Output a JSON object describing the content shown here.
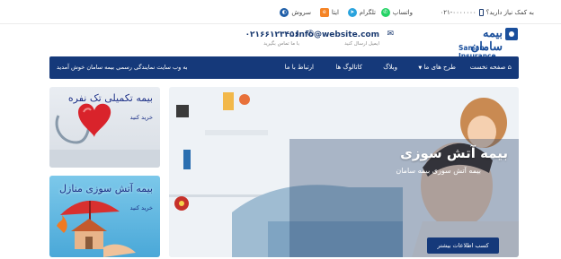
{
  "topbar": {
    "help_text": "به کمک نیاز دارید؟",
    "help_phone": "۰۲۱-۰۰۰۰۰۰۰",
    "social": [
      {
        "label": "واتساپ",
        "icon": "whatsapp-icon",
        "color": "#25d366"
      },
      {
        "label": "تلگرام",
        "icon": "telegram-icon",
        "color": "#2aa3dd"
      },
      {
        "label": "ایتا",
        "icon": "eitaa-icon",
        "color": "#f58426"
      },
      {
        "label": "سروش",
        "icon": "soroush-icon",
        "color": "#1f5ea8"
      }
    ]
  },
  "header": {
    "logo_fa": "بیمه سامان",
    "logo_en": "Saman Insurance",
    "email": "info@website.com",
    "email_sub": "ایمیل ارسال کنید",
    "phone": "۰۲۱۶۶۱۲۳۴۵۶",
    "phone_sub": "با ما تماس بگیرید"
  },
  "nav": {
    "items": [
      {
        "label": "صفحه نخست",
        "icon": "home-icon"
      },
      {
        "label": "طرح های ما",
        "has_dropdown": true
      },
      {
        "label": "وبلاگ"
      },
      {
        "label": "کاتالوگ ها"
      },
      {
        "label": "ارتباط با ما"
      }
    ],
    "welcome": "به وب سایت نمایندگی رسمی بیمه سامان خوش آمدید"
  },
  "cards": [
    {
      "title": "بیمه تکمیلی تک نفره",
      "link": "خرید کنید"
    },
    {
      "title": "بیمه آتش سوزی منازل",
      "link": "خرید کنید"
    }
  ],
  "hero": {
    "title": "بیمه آتش سوزی",
    "subtitle": "بیمه آتش سوزی بیمه سامان",
    "button": "کسب اطلاعات بیشتر"
  },
  "colors": {
    "brand": "#15397a",
    "card_title": "#1b2f86"
  }
}
